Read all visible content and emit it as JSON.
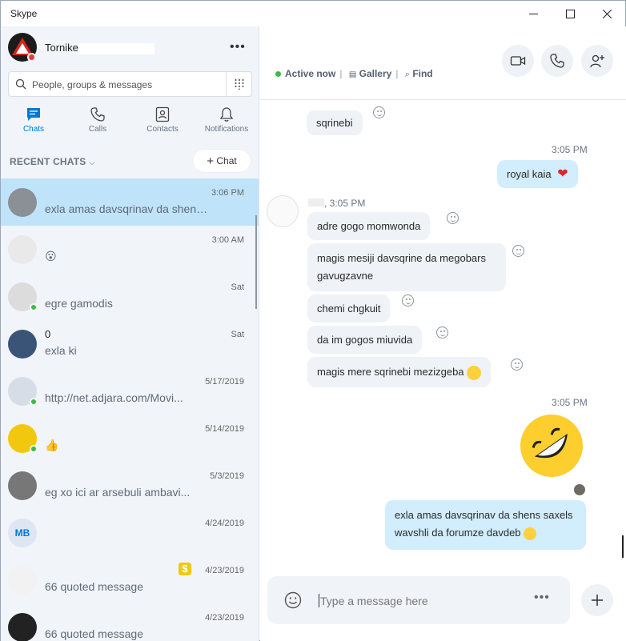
{
  "window": {
    "title": "Skype"
  },
  "profile": {
    "name": "Tornike"
  },
  "search": {
    "placeholder": "People, groups & messages"
  },
  "nav": {
    "tabs": [
      {
        "label": "Chats",
        "active": true
      },
      {
        "label": "Calls"
      },
      {
        "label": "Contacts"
      },
      {
        "label": "Notifications"
      }
    ]
  },
  "recent_chats_label": "RECENT CHATS",
  "new_chat_label": "Chat",
  "chats": [
    {
      "name": "",
      "time": "3:06 PM",
      "message": "exla amas davsqrinav da shens saxels wavshli da forumze davdeb",
      "selected": true
    },
    {
      "name": "",
      "time": "3:00 AM",
      "message": "😮"
    },
    {
      "name": "",
      "time": "Sat",
      "message": "egre gamodis"
    },
    {
      "name": "0",
      "time": "Sat",
      "message": "exla ki"
    },
    {
      "name": "",
      "time": "5/17/2019",
      "message": "http://net.adjara.com/Movi..."
    },
    {
      "name": "",
      "time": "5/14/2019",
      "message": "👍"
    },
    {
      "name": "",
      "time": "5/3/2019",
      "message": "eg xo ici ar arsebuli ambavi..."
    },
    {
      "name": "",
      "time": "4/24/2019",
      "message": "",
      "initials": "MB"
    },
    {
      "name": "",
      "time": "4/23/2019",
      "message": "66 quoted message"
    },
    {
      "name": "",
      "time": "4/23/2019",
      "message": "66 quoted message"
    }
  ],
  "conversation": {
    "status_active": "Active now",
    "gallery_label": "Gallery",
    "find_label": "Find",
    "messages": [
      {
        "dir": "in",
        "text": "sqrinebi"
      },
      {
        "dir": "out",
        "time": "3:05 PM",
        "text": "royal kaia"
      },
      {
        "dir": "in",
        "time": "3:05 PM",
        "text": "adre gogo momwonda"
      },
      {
        "dir": "in",
        "text": "magis mesiji davsqrine da megobars gavugzavne"
      },
      {
        "dir": "in",
        "text": "chemi chgkuit"
      },
      {
        "dir": "in",
        "text": "da im gogos miuvida"
      },
      {
        "dir": "in",
        "text": "magis mere sqrinebi mezizgeba"
      },
      {
        "dir": "out",
        "time": "3:05 PM",
        "text": ""
      },
      {
        "dir": "out",
        "text": "exla amas davsqrinav da shens saxels wavshli da forumze davdeb"
      }
    ]
  },
  "composer": {
    "placeholder": "Type a message here"
  },
  "colors": {
    "accent": "#0078d4",
    "selected_row": "#bfe4fa",
    "outgoing_bubble": "#d2edfb",
    "incoming_bubble": "#eff2f6",
    "online": "#3dbb45"
  }
}
